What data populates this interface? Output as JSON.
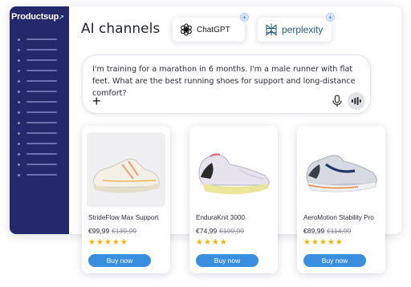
{
  "brand": {
    "name": "Productsup"
  },
  "header": {
    "title": "AI channels"
  },
  "channels": [
    {
      "label": "ChatGPT",
      "icon": "chatgpt-icon"
    },
    {
      "label": "perplexity",
      "icon": "perplexity-icon"
    }
  ],
  "prompt": {
    "text": "I'm training for a marathon in 6 months. I'm a male runner with flat feet. What are the best running shoes for support and long-distance comfort?",
    "add_icon": "plus-icon",
    "mic_icon": "microphone-icon",
    "voice_icon": "voice-mode-icon"
  },
  "products": [
    {
      "name": "StrideFlow Max Support",
      "price": "€99,99",
      "old_price": "€139,99",
      "stars": "★★★★★",
      "rating": 5,
      "button": "Buy now"
    },
    {
      "name": "EnduraKnit 3000",
      "price": "€74,99",
      "old_price": "€109,99",
      "stars": "★★★★",
      "rating": 4,
      "button": "Buy now"
    },
    {
      "name": "AeroMotion Stability Pro",
      "price": "€89,99",
      "old_price": "€114,99",
      "stars": "★★★★★",
      "rating": 5,
      "button": "Buy now"
    }
  ],
  "colors": {
    "sidebar": "#24296b",
    "accent": "#3a8ee0",
    "star": "#f0b400"
  }
}
